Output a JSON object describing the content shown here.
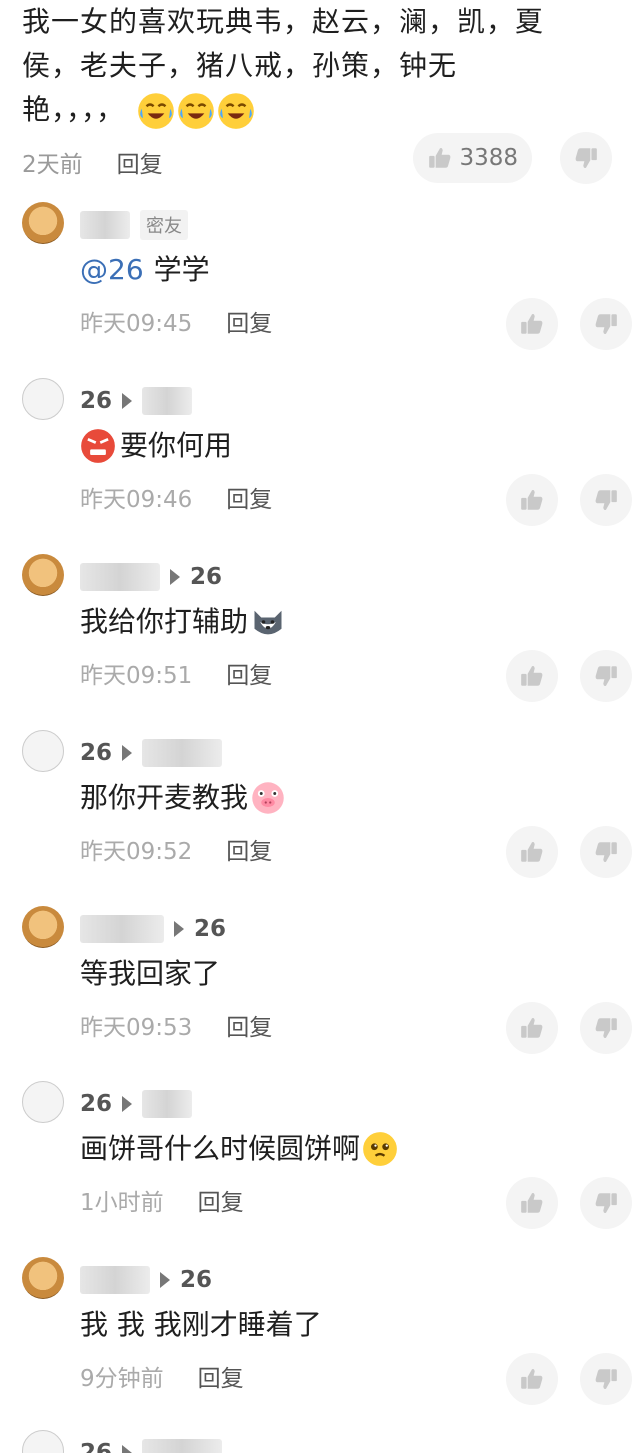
{
  "top_comment": {
    "text_line1": "我一女的喜欢玩典韦，赵云，澜，凯，夏",
    "text_line2": "侯，老夫子，猪八戒，孙策，钟无",
    "text_line3": "艳，，，，",
    "time": "2天前",
    "reply_label": "回复",
    "like_count": "3388"
  },
  "replies": [
    {
      "author_tag": "密友",
      "mention": "@26",
      "text": "学学",
      "time": "昨天09:45",
      "reply_label": "回复"
    },
    {
      "author": "26",
      "text": "要你何用",
      "time": "昨天09:46",
      "reply_label": "回复"
    },
    {
      "target": "26",
      "text": "我给你打辅助",
      "time": "昨天09:51",
      "reply_label": "回复"
    },
    {
      "author": "26",
      "text": "那你开麦教我",
      "time": "昨天09:52",
      "reply_label": "回复"
    },
    {
      "target": "26",
      "text": "等我回家了",
      "time": "昨天09:53",
      "reply_label": "回复"
    },
    {
      "author": "26",
      "text": "画饼哥什么时候圆饼啊",
      "time": "1小时前",
      "reply_label": "回复"
    },
    {
      "target": "26",
      "text": "我 我 我刚才睡着了",
      "time": "9分钟前",
      "reply_label": "回复"
    },
    {
      "author": "26"
    }
  ],
  "icons": {
    "like": "thumbs-up-icon",
    "dislike": "thumbs-down-icon"
  }
}
